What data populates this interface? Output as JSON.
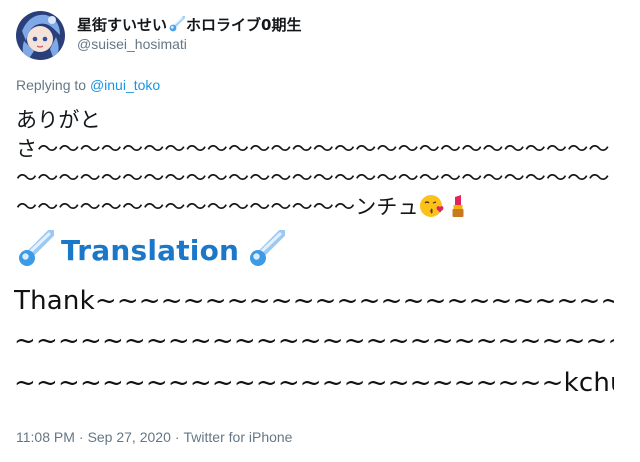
{
  "profile": {
    "display_name_part1": "星街すいせい",
    "display_name_part2": "ホロライブ0期生",
    "handle": "@suisei_hosimati",
    "name_emoji": "comet-icon"
  },
  "reply": {
    "prefix": "Replying to",
    "mention": "@inui_toko"
  },
  "tweet": {
    "text_start": "ありがとさ",
    "text_end": "ンチュ",
    "emojis": [
      "kissing-face-with-heart-icon",
      "lipstick-icon"
    ]
  },
  "translation": {
    "title": "Translation",
    "line1": "Thank~~~~~~~~~~~~~~~~~~~~~~~~~",
    "line2": "~~~~~~~~~~~~~~~~~~~~~~~~~~~~~",
    "line3_text": "~~~~~~~~~~~~~~~~~~~~~~~~~kchu"
  },
  "meta": {
    "time": "11:08 PM",
    "sep1": "·",
    "date": "Sep 27, 2020",
    "sep2": "·",
    "source": "Twitter for iPhone"
  },
  "colors": {
    "link": "#1b95e0",
    "translation": "#1b78c8",
    "muted": "#657786"
  }
}
